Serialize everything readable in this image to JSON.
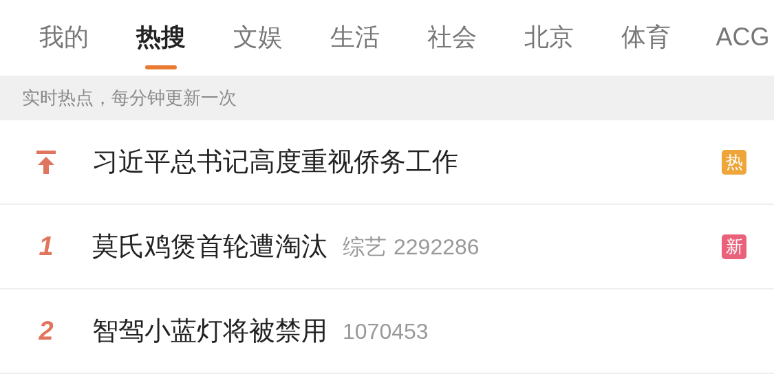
{
  "tabs": [
    {
      "label": "我的",
      "selected": false
    },
    {
      "label": "热搜",
      "selected": true
    },
    {
      "label": "文娱",
      "selected": false
    },
    {
      "label": "生活",
      "selected": false
    },
    {
      "label": "社会",
      "selected": false
    },
    {
      "label": "北京",
      "selected": false
    },
    {
      "label": "体育",
      "selected": false
    },
    {
      "label": "ACG",
      "selected": false
    }
  ],
  "notice": "实时热点，每分钟更新一次",
  "items": [
    {
      "kind": "pinned",
      "title": "习近平总书记高度重视侨务工作",
      "badge": "热",
      "color": "#eea63a"
    },
    {
      "kind": "rank",
      "rank": "1",
      "title": "莫氏鸡煲首轮遭淘汰",
      "category": "综艺",
      "count": "2292286",
      "badge": "新",
      "color": "#e9617a"
    },
    {
      "kind": "rank",
      "rank": "2",
      "title": "智驾小蓝灯将被禁用",
      "count": "1070453"
    }
  ]
}
